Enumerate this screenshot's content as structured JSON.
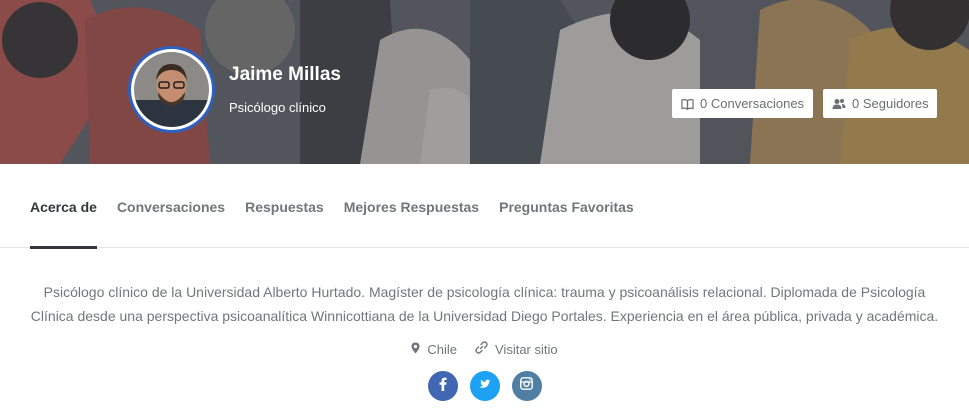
{
  "profile": {
    "name": "Jaime Millas",
    "role": "Psicólogo clínico",
    "avatar_ring_color": "#2f5fbf"
  },
  "stats": {
    "conversations": {
      "icon": "book-open-icon",
      "label": "0 Conversaciones"
    },
    "followers": {
      "icon": "users-icon",
      "label": "0 Seguidores"
    }
  },
  "tabs": [
    {
      "label": "Acerca de",
      "active": true
    },
    {
      "label": "Conversaciones",
      "active": false
    },
    {
      "label": "Respuestas",
      "active": false
    },
    {
      "label": "Mejores Respuestas",
      "active": false
    },
    {
      "label": "Preguntas Favoritas",
      "active": false
    }
  ],
  "about": {
    "bio": "Psicólogo clínico de la Universidad Alberto Hurtado. Magíster de psicología clínica: trauma y psicoanálisis relacional. Diplomada de Psicología Clínica desde una perspectiva psicoanalítica Winnicottiana de la Universidad Diego Portales. Experiencia en el área pública, privada y académica.",
    "location": {
      "icon": "map-pin-icon",
      "label": "Chile"
    },
    "website": {
      "icon": "link-icon",
      "label": "Visitar sitio"
    }
  },
  "social": [
    {
      "icon": "facebook-icon",
      "color": "#4267b2"
    },
    {
      "icon": "twitter-icon",
      "color": "#1da1f2"
    },
    {
      "icon": "instagram-icon",
      "color": "#517fa4"
    }
  ],
  "colors": {
    "text_muted": "#72767c",
    "text_dark": "#33373d",
    "banner_overlay": "#5c5f66"
  }
}
